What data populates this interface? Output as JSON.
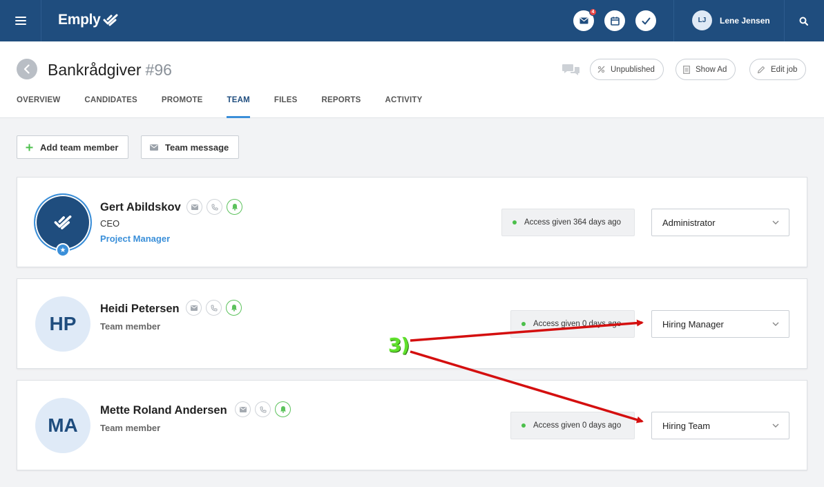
{
  "app": {
    "brand": "Emply",
    "mail_badge": "4"
  },
  "user": {
    "initials": "LJ",
    "name": "Lene Jensen"
  },
  "job": {
    "title": "Bankrådgiver",
    "number": "#96"
  },
  "header_buttons": {
    "unpublished": "Unpublished",
    "show_ad": "Show Ad",
    "edit_job": "Edit job"
  },
  "tabs": [
    {
      "label": "OVERVIEW"
    },
    {
      "label": "CANDIDATES"
    },
    {
      "label": "PROMOTE"
    },
    {
      "label": "TEAM",
      "active": true
    },
    {
      "label": "FILES"
    },
    {
      "label": "REPORTS"
    },
    {
      "label": "ACTIVITY"
    }
  ],
  "actions": {
    "add_member": "Add team member",
    "team_message": "Team message"
  },
  "members": [
    {
      "name": "Gert Abildskov",
      "role": "CEO",
      "link": "Project Manager",
      "access": "Access given 364 days ago",
      "permission": "Administrator"
    },
    {
      "initials": "HP",
      "name": "Heidi Petersen",
      "role": "Team member",
      "access": "Access given 0 days ago",
      "permission": "Hiring Manager"
    },
    {
      "initials": "MA",
      "name": "Mette Roland Andersen",
      "role": "Team member",
      "access": "Access given 0 days ago",
      "permission": "Hiring Team"
    }
  ],
  "annotation": {
    "label": "3)",
    "color": "#5fe02c",
    "arrow_color": "#d40f0f"
  },
  "colors": {
    "topbar": "#1f4d7e",
    "accent": "#3a8fd9",
    "status_green": "#4bbf4b"
  }
}
